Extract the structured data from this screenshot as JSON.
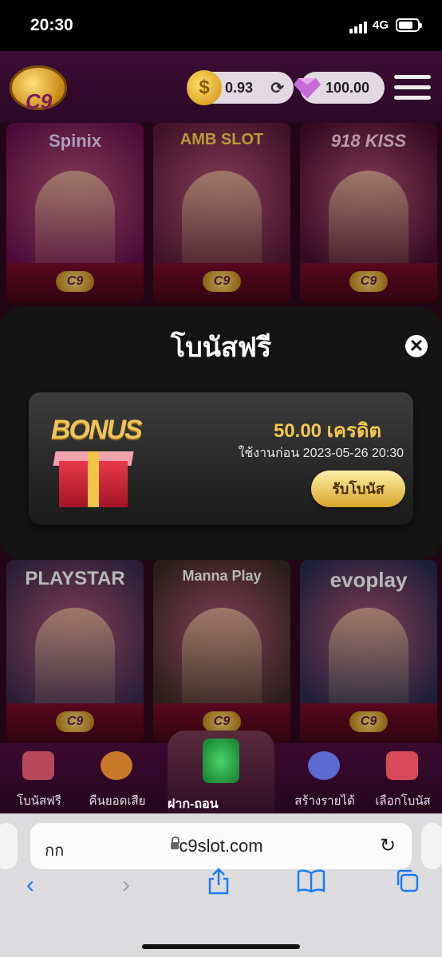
{
  "status_bar": {
    "time": "20:30",
    "network": "4G"
  },
  "header": {
    "logo_text": "C9",
    "credit_balance": "0.93",
    "gem_balance": "100.00"
  },
  "games_top": [
    {
      "brand": "Spinix",
      "color": "#6b0f4d"
    },
    {
      "brand": "AMB SLOT",
      "color": "#5a1a36"
    },
    {
      "brand": "918 KISS",
      "color": "#4a0d2c"
    }
  ],
  "games_bottom": [
    {
      "brand": "PLAYSTAR",
      "color": "#3b2a4d"
    },
    {
      "brand": "Manna Play",
      "color": "#3a2a24"
    },
    {
      "brand": "evoplay",
      "color": "#2a2a4d"
    }
  ],
  "modal": {
    "title": "โบนัสฟรี",
    "bonus_art_word": "BONUS",
    "amount": "50.00 เครดิต",
    "expiry": "ใช้งานก่อน 2023-05-26 20:30",
    "claim_label": "รับโบนัส"
  },
  "bottom_nav": [
    {
      "label": "โบนัสฟรี",
      "icon": "gift-icon"
    },
    {
      "label": "คืนยอดเสีย",
      "icon": "cashback-icon"
    },
    {
      "label": "ฝาก-ถอน",
      "icon": "money-icon"
    },
    {
      "label": "สร้างรายได้",
      "icon": "people-icon"
    },
    {
      "label": "เลือกโบนัส",
      "icon": "megaphone-icon"
    }
  ],
  "browser": {
    "aa_label": "กก",
    "url": "c9slot.com"
  },
  "colors": {
    "accent_gold": "#f3c84f",
    "bg_purple": "#30091f"
  }
}
